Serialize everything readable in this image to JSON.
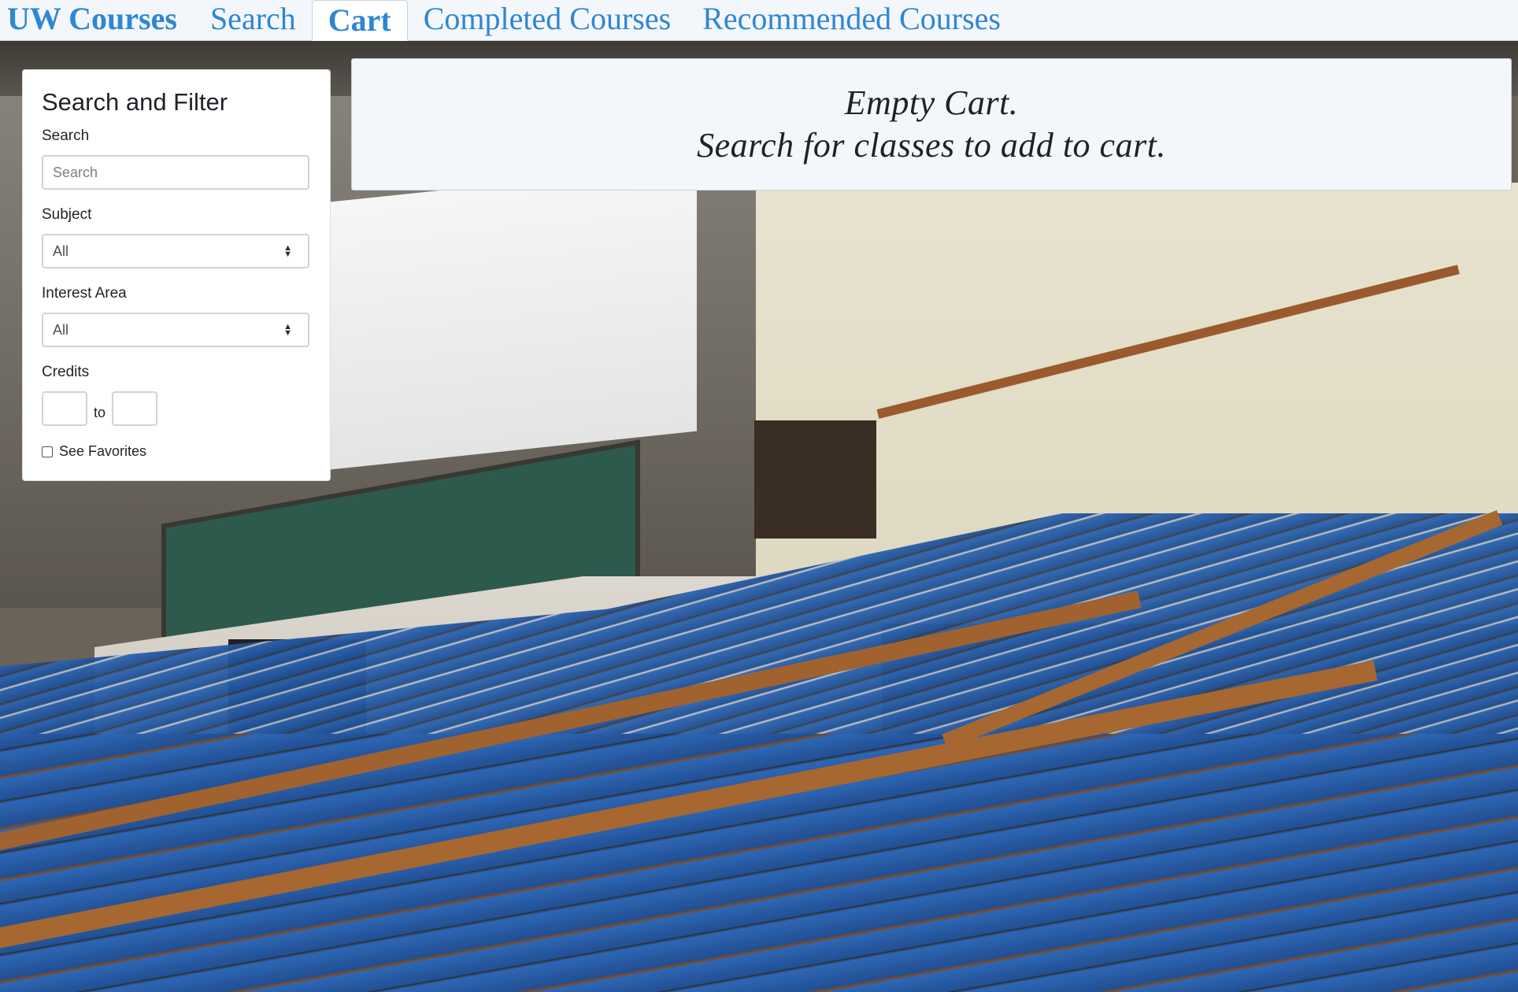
{
  "nav": {
    "brand": "UW Courses",
    "tabs": [
      {
        "label": "Search",
        "active": false
      },
      {
        "label": "Cart",
        "active": true
      },
      {
        "label": "Completed Courses",
        "active": false
      },
      {
        "label": "Recommended Courses",
        "active": false
      }
    ],
    "link_color": "#2f86d3"
  },
  "filter": {
    "title": "Search and Filter",
    "search_label": "Search",
    "search_placeholder": "Search",
    "subject_label": "Subject",
    "subject_value": "All",
    "interest_label": "Interest Area",
    "interest_value": "All",
    "credits_label": "Credits",
    "credits_to": "to",
    "favorites_label": "See Favorites"
  },
  "cart": {
    "line1": "Empty Cart.",
    "line2": "Search for classes to add to cart."
  }
}
